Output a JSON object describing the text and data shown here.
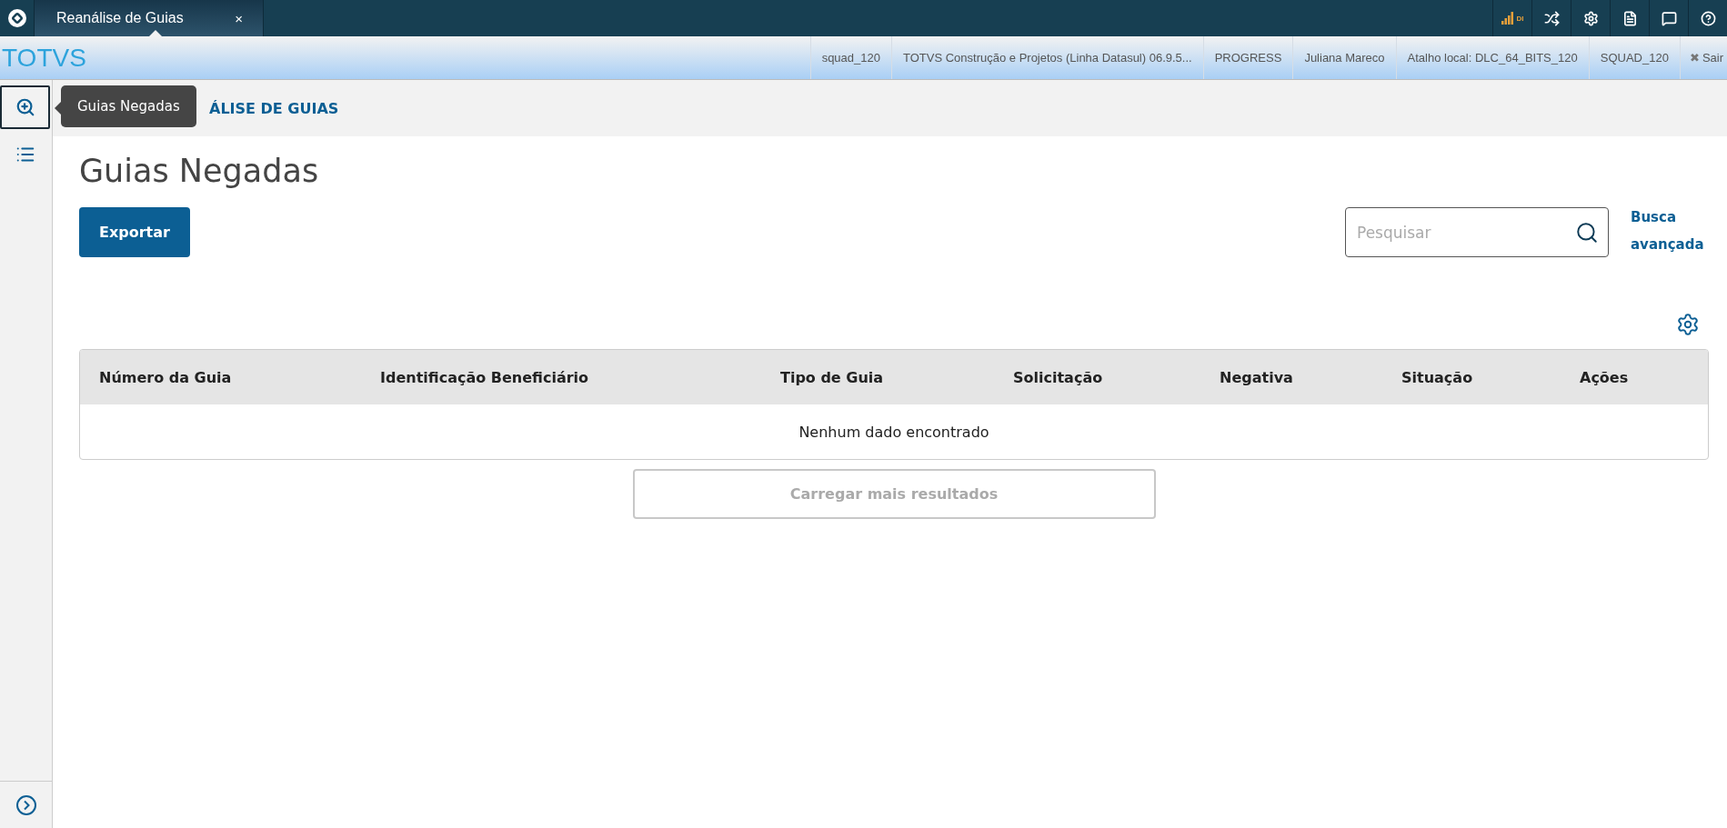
{
  "tabs": [
    {
      "label": "Reanálise de Guias",
      "close": "×",
      "selected": true
    }
  ],
  "top_icons": [
    {
      "kind": "signal",
      "label": "DI"
    },
    {
      "kind": "shuffle"
    },
    {
      "kind": "gear"
    },
    {
      "kind": "file"
    },
    {
      "kind": "chat"
    },
    {
      "kind": "help"
    }
  ],
  "brand": "TOTVS",
  "session_items": [
    "squad_120",
    "TOTVS Construção e Projetos (Linha Datasul) 06.9.5...",
    "PROGRESS",
    "Juliana Mareco",
    "Atalho local: DLC_64_BITS_120",
    "SQUAD_120"
  ],
  "logout": {
    "label": "Sair",
    "icon": "✖"
  },
  "sidebar": {
    "items": [
      {
        "kind": "zoom",
        "selected": true
      },
      {
        "kind": "list",
        "selected": false
      }
    ]
  },
  "tooltip": "Guias Negadas",
  "breadcrumb": "ÁLISE DE GUIAS",
  "page_title": "Guias Negadas",
  "export_button": "Exportar",
  "search": {
    "placeholder": "Pesquisar"
  },
  "advanced_search": "Busca avançada",
  "table": {
    "columns": [
      "Número da Guia",
      "Identificação Beneficiário",
      "Tipo de Guia",
      "Solicitação",
      "Negativa",
      "Situação",
      "Ações"
    ],
    "empty_message": "Nenhum dado encontrado"
  },
  "load_more": {
    "label": "Carregar mais resultados",
    "disabled": true
  }
}
